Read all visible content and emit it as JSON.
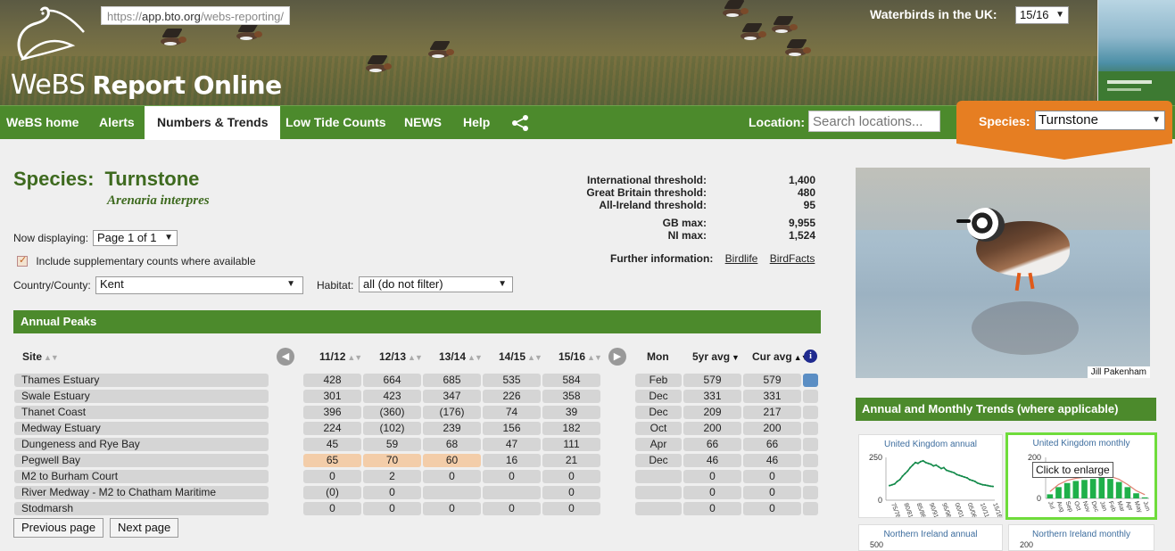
{
  "header": {
    "url_prefix": "https://",
    "url_domain": "app.bto.org",
    "url_path": "/webs-reporting/",
    "logo_webs": "WeBS",
    "logo_report": "Report Online",
    "waterbirds_label": "Waterbirds in the UK:",
    "waterbirds_value": "15/16"
  },
  "nav": {
    "items": [
      "WeBS home",
      "Alerts",
      "Numbers & Trends",
      "Low Tide Counts",
      "NEWS",
      "Help"
    ],
    "active": "Numbers & Trends",
    "location_label": "Location:",
    "location_placeholder": "Search locations...",
    "species_label": "Species:",
    "species_value": "Turnstone"
  },
  "species": {
    "label": "Species:",
    "name": "Turnstone",
    "latin": "Arenaria interpres"
  },
  "thresholds": [
    {
      "label": "International threshold:",
      "value": "1,400"
    },
    {
      "label": "Great Britain threshold:",
      "value": "480"
    },
    {
      "label": "All-Ireland threshold:",
      "value": "95"
    },
    {
      "label": "GB max:",
      "value": "9,955"
    },
    {
      "label": "NI max:",
      "value": "1,524"
    }
  ],
  "further_info": {
    "label": "Further information:",
    "links": [
      "Birdlife",
      "BirdFacts"
    ]
  },
  "controls": {
    "now_displaying_label": "Now displaying:",
    "page_value": "Page 1 of 1",
    "include_supp_label": "Include supplementary counts where available",
    "country_label": "Country/County:",
    "country_value": "Kent",
    "habitat_label": "Habitat:",
    "habitat_value": "all (do not filter)"
  },
  "annual_peaks": {
    "title": "Annual Peaks",
    "headers": {
      "site": "Site",
      "years": [
        "11/12",
        "12/13",
        "13/14",
        "14/15",
        "15/16"
      ],
      "mon": "Mon",
      "avg5": "5yr avg",
      "cur": "Cur avg"
    },
    "rows": [
      {
        "site": "Thames Estuary",
        "vals": [
          "428",
          "664",
          "685",
          "535",
          "584"
        ],
        "mon": "Feb",
        "avg5": "579",
        "cur": "579",
        "hl": [],
        "flag": "blue"
      },
      {
        "site": "Swale Estuary",
        "vals": [
          "301",
          "423",
          "347",
          "226",
          "358"
        ],
        "mon": "Dec",
        "avg5": "331",
        "cur": "331",
        "hl": [],
        "flag": ""
      },
      {
        "site": "Thanet Coast",
        "vals": [
          "396",
          "(360)",
          "(176)",
          "74",
          "39"
        ],
        "mon": "Dec",
        "avg5": "209",
        "cur": "217",
        "hl": [],
        "flag": ""
      },
      {
        "site": "Medway Estuary",
        "vals": [
          "224",
          "(102)",
          "239",
          "156",
          "182"
        ],
        "mon": "Oct",
        "avg5": "200",
        "cur": "200",
        "hl": [],
        "flag": ""
      },
      {
        "site": "Dungeness and Rye Bay",
        "vals": [
          "45",
          "59",
          "68",
          "47",
          "111"
        ],
        "mon": "Apr",
        "avg5": "66",
        "cur": "66",
        "hl": [],
        "flag": ""
      },
      {
        "site": "Pegwell Bay",
        "vals": [
          "65",
          "70",
          "60",
          "16",
          "21"
        ],
        "mon": "Dec",
        "avg5": "46",
        "cur": "46",
        "hl": [
          0,
          1,
          2
        ],
        "flag": ""
      },
      {
        "site": "M2 to Burham Court",
        "vals": [
          "0",
          "2",
          "0",
          "0",
          "0"
        ],
        "mon": "",
        "avg5": "0",
        "cur": "0",
        "hl": [],
        "flag": ""
      },
      {
        "site": "River Medway - M2 to Chatham Maritime",
        "vals": [
          "(0)",
          "0",
          "",
          "",
          "0"
        ],
        "mon": "",
        "avg5": "0",
        "cur": "0",
        "hl": [],
        "flag": ""
      },
      {
        "site": "Stodmarsh",
        "vals": [
          "0",
          "0",
          "0",
          "0",
          "0"
        ],
        "mon": "",
        "avg5": "0",
        "cur": "0",
        "hl": [],
        "flag": ""
      }
    ],
    "prev_label": "Previous page",
    "next_label": "Next page"
  },
  "photo_credit": "Jill Pakenham",
  "trends": {
    "title": "Annual and Monthly Trends (where applicable)",
    "tooltip": "Click to enlarge",
    "charts": [
      {
        "title": "United Kingdom annual",
        "y_top": "250",
        "y_bottom": "0",
        "x_labels": [
          "75/76",
          "80/81",
          "85/86",
          "90/91",
          "95/96",
          "00/01",
          "05/06",
          "10/11",
          "15/16"
        ]
      },
      {
        "title": "United Kingdom monthly",
        "y_top": "200",
        "y_bottom": "0",
        "x_labels": [
          "Jul",
          "Aug",
          "Sep",
          "Oct",
          "Nov",
          "Dec",
          "Jan",
          "Feb",
          "Mar",
          "Apr",
          "May",
          "Jun"
        ]
      },
      {
        "title": "Northern Ireland annual",
        "y_top": "500"
      },
      {
        "title": "Northern Ireland monthly",
        "y_top": "200"
      }
    ]
  },
  "chart_data": [
    {
      "type": "line",
      "title": "United Kingdom annual",
      "ylim": [
        0,
        250
      ],
      "x": [
        "75/76",
        "76/77",
        "77/78",
        "78/79",
        "79/80",
        "80/81",
        "81/82",
        "82/83",
        "83/84",
        "84/85",
        "85/86",
        "86/87",
        "87/88",
        "88/89",
        "89/90",
        "90/91",
        "91/92",
        "92/93",
        "93/94",
        "94/95",
        "95/96",
        "96/97",
        "97/98",
        "98/99",
        "99/00",
        "00/01",
        "01/02",
        "02/03",
        "03/04",
        "04/05",
        "05/06",
        "06/07",
        "07/08",
        "08/09",
        "09/10",
        "10/11",
        "11/12",
        "12/13",
        "13/14",
        "14/15",
        "15/16"
      ],
      "values": [
        85,
        90,
        95,
        110,
        120,
        140,
        155,
        170,
        190,
        205,
        220,
        215,
        225,
        230,
        220,
        215,
        210,
        200,
        205,
        195,
        185,
        190,
        175,
        170,
        165,
        160,
        150,
        145,
        140,
        135,
        130,
        120,
        115,
        110,
        100,
        95,
        90,
        88,
        85,
        82,
        80
      ]
    },
    {
      "type": "bar",
      "title": "United Kingdom monthly",
      "ylim": [
        0,
        200
      ],
      "categories": [
        "Jul",
        "Aug",
        "Sep",
        "Oct",
        "Nov",
        "Dec",
        "Jan",
        "Feb",
        "Mar",
        "Apr",
        "May",
        "Jun"
      ],
      "values": [
        20,
        55,
        75,
        85,
        90,
        95,
        100,
        95,
        80,
        55,
        25,
        5
      ]
    }
  ]
}
